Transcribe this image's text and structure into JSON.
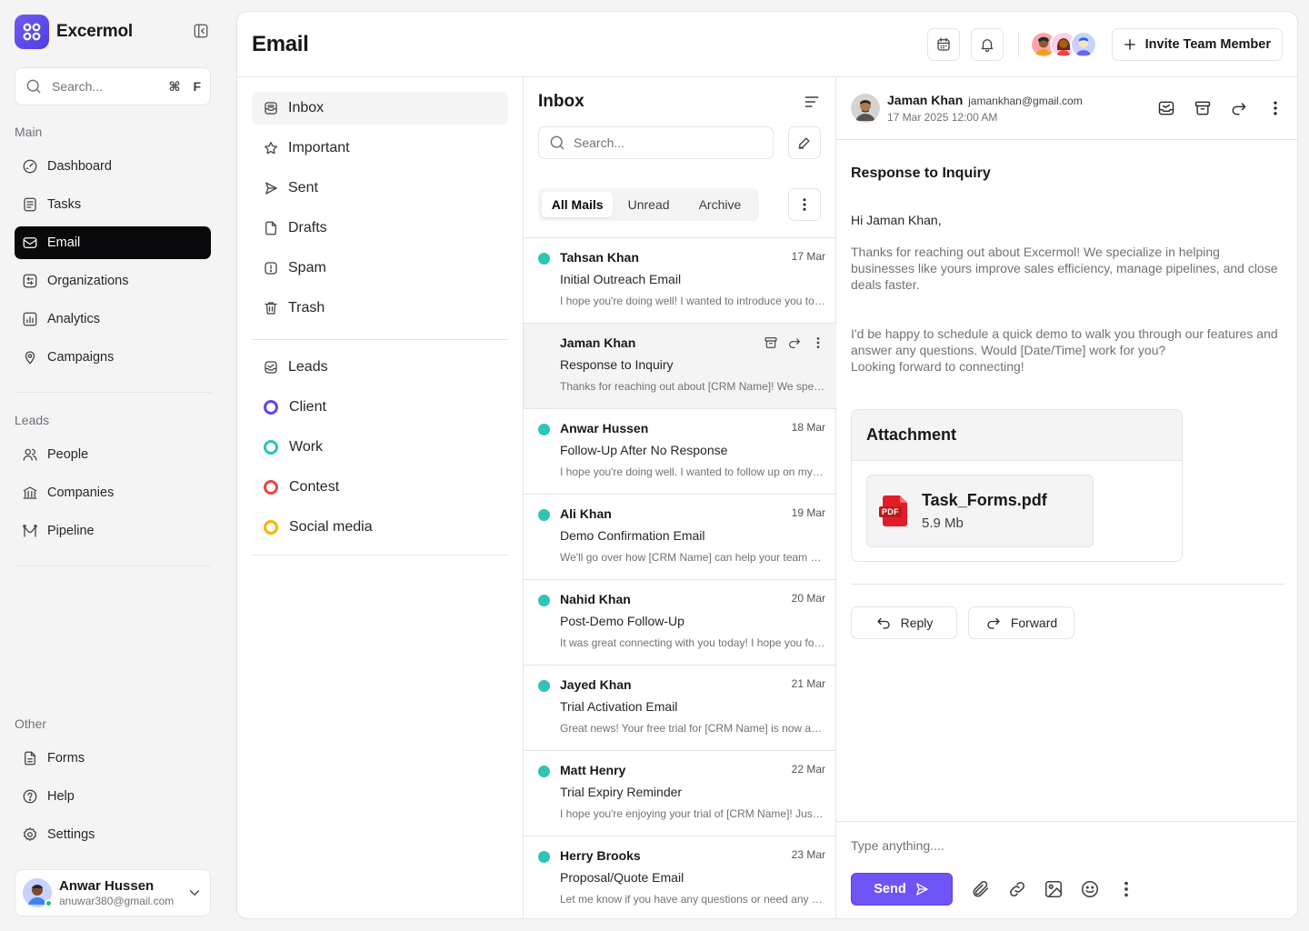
{
  "brand": {
    "name": "Excermol",
    "color": "#5b46ef"
  },
  "sidebar": {
    "search_placeholder": "Search...",
    "shortcut_cmd": "⌘",
    "shortcut_key": "F",
    "main_label": "Main",
    "main_items": [
      {
        "label": "Dashboard",
        "icon": "gauge-icon"
      },
      {
        "label": "Tasks",
        "icon": "clipboard-list-icon"
      },
      {
        "label": "Email",
        "icon": "mail-icon",
        "active": true
      },
      {
        "label": "Organizations",
        "icon": "organization-icon"
      },
      {
        "label": "Analytics",
        "icon": "chart-icon"
      },
      {
        "label": "Campaigns",
        "icon": "map-pin-icon"
      }
    ],
    "leads_label": "Leads",
    "leads_items": [
      {
        "label": "People",
        "icon": "users-icon"
      },
      {
        "label": "Companies",
        "icon": "bank-icon"
      },
      {
        "label": "Pipeline",
        "icon": "pipeline-icon"
      }
    ],
    "other_label": "Other",
    "other_items": [
      {
        "label": "Forms",
        "icon": "file-icon"
      },
      {
        "label": "Help",
        "icon": "help-icon"
      },
      {
        "label": "Settings",
        "icon": "gear-icon"
      }
    ],
    "user": {
      "name": "Anwar Hussen",
      "email": "anuwar380@gmail.com",
      "status_color": "#22c55e"
    }
  },
  "header": {
    "title": "Email",
    "invite_label": "Invite Team Member"
  },
  "folders": {
    "items": [
      {
        "label": "Inbox",
        "icon": "inbox-icon",
        "active": true
      },
      {
        "label": "Important",
        "icon": "star-icon"
      },
      {
        "label": "Sent",
        "icon": "send-icon"
      },
      {
        "label": "Drafts",
        "icon": "draft-icon"
      },
      {
        "label": "Spam",
        "icon": "alert-icon"
      },
      {
        "label": "Trash",
        "icon": "trash-icon"
      }
    ],
    "leads_label": "Leads",
    "labels": [
      {
        "label": "Client",
        "color": "#5b46ef"
      },
      {
        "label": "Work",
        "color": "#2ec4b6"
      },
      {
        "label": "Contest",
        "color": "#ef4444"
      },
      {
        "label": "Social media",
        "color": "#f5b400"
      }
    ]
  },
  "inbox": {
    "title": "Inbox",
    "search_placeholder": "Search...",
    "tabs": [
      "All Mails",
      "Unread",
      "Archive"
    ],
    "unread_color": "#2ec4b6",
    "mails": [
      {
        "from": "Tahsan Khan",
        "date": "17 Mar",
        "subject": "Initial Outreach Email",
        "preview": "I hope you're doing well! I wanted to introduce you to Excermol.",
        "unread": true
      },
      {
        "from": "Jaman Khan",
        "date": "",
        "subject": "Response to Inquiry",
        "preview": "Thanks for reaching out about [CRM Name]! We specialize in helping businesses.",
        "unread": false,
        "selected": true
      },
      {
        "from": "Anwar Hussen",
        "date": "18 Mar",
        "subject": "Follow-Up After No Response",
        "preview": "I hope you're doing well. I wanted to follow up on my previous email.",
        "unread": true
      },
      {
        "from": "Ali Khan",
        "date": "19 Mar",
        "subject": "Demo Confirmation Email",
        "preview": "We'll go over how [CRM Name] can help your team overcome challenges.",
        "unread": true
      },
      {
        "from": "Nahid Khan",
        "date": "20 Mar",
        "subject": "Post-Demo Follow-Up",
        "preview": "It was great connecting with you today! I hope you found the demo useful.",
        "unread": true
      },
      {
        "from": "Jayed Khan",
        "date": "21 Mar",
        "subject": "Trial Activation Email",
        "preview": "Great news! Your free trial for [CRM Name] is now active.",
        "unread": true
      },
      {
        "from": "Matt Henry",
        "date": "22 Mar",
        "subject": "Trial Expiry Reminder",
        "preview": "I hope you're enjoying your trial of [CRM Name]! Just a quick reminder.",
        "unread": true
      },
      {
        "from": "Herry Brooks",
        "date": "23 Mar",
        "subject": "Proposal/Quote Email",
        "preview": "Let me know if you have any questions or need any adjustments.",
        "unread": true
      }
    ]
  },
  "reader": {
    "sender_name": "Jaman Khan",
    "sender_email": "jamankhan@gmail.com",
    "date": "17 Mar 2025 12:00 AM",
    "subject": "Response to Inquiry",
    "greeting": "Hi Jaman Khan,",
    "paragraph1": "Thanks for reaching out about Excermol! We specialize in helping businesses like yours improve sales efficiency, manage pipelines, and close deals faster.",
    "paragraph2": "I'd be happy to schedule a quick demo to walk you through our features and answer any questions. Would [Date/Time] work for you?",
    "paragraph3": "Looking forward to connecting!",
    "attachment_title": "Attachment",
    "file_name": "Task_Forms.pdf",
    "file_size": "5.9 Mb",
    "file_badge": "PDF",
    "reply_label": "Reply",
    "forward_label": "Forward",
    "compose_placeholder": "Type anything....",
    "send_label": "Send",
    "accent": "#6d54f5"
  }
}
